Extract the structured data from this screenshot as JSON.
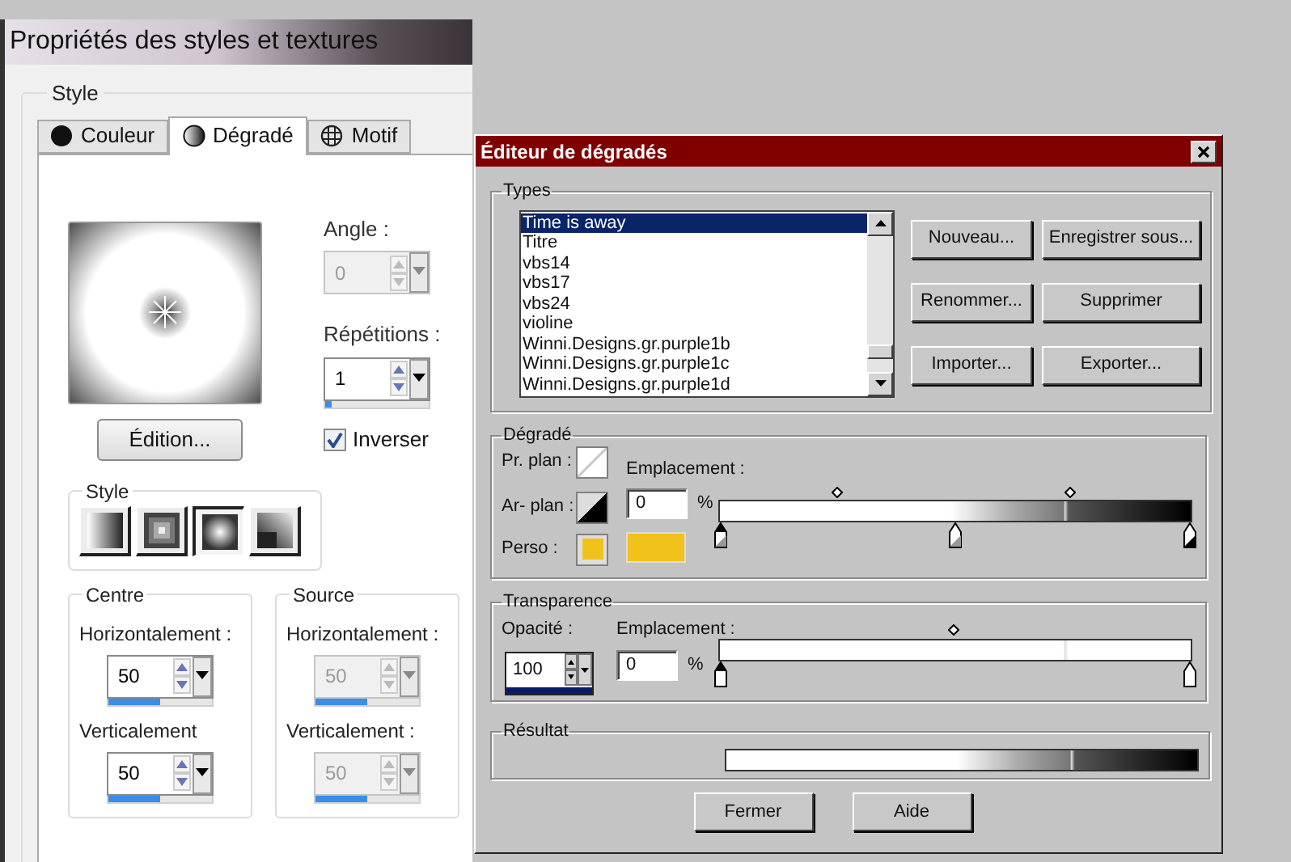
{
  "style_window": {
    "title": "Propriétés des styles et textures",
    "group_label": "Style",
    "tabs": [
      {
        "label": "Couleur",
        "kind": "color",
        "selected": false
      },
      {
        "label": "Dégradé",
        "kind": "gradient",
        "selected": true
      },
      {
        "label": "Motif",
        "kind": "pattern",
        "selected": false
      }
    ],
    "angle": {
      "label": "Angle :",
      "value": "0",
      "disabled": true
    },
    "repetitions": {
      "label": "Répétitions :",
      "value": "1",
      "disabled": false,
      "level": 0.06
    },
    "edit_button": "Édition...",
    "invert": {
      "label": "Inverser",
      "checked": true
    },
    "style_group": {
      "label": "Style",
      "options": [
        {
          "kind": "linear",
          "selected": false
        },
        {
          "kind": "rectangular",
          "selected": false
        },
        {
          "kind": "sunburst",
          "selected": true
        },
        {
          "kind": "radial",
          "selected": false
        }
      ]
    },
    "centre": {
      "label": "Centre",
      "fields": [
        {
          "label": "Horizontalement :",
          "value": "50",
          "disabled": false,
          "level": 0.5
        },
        {
          "label": "Verticalement",
          "value": "50",
          "disabled": false,
          "level": 0.5
        }
      ]
    },
    "source": {
      "label": "Source",
      "fields": [
        {
          "label": "Horizontalement :",
          "value": "50",
          "disabled": true,
          "level": 0.5
        },
        {
          "label": "Verticalement :",
          "value": "50",
          "disabled": true,
          "level": 0.5
        }
      ]
    }
  },
  "gradient_editor": {
    "title": "Éditeur de dégradés",
    "types": {
      "label": "Types",
      "items": [
        {
          "label": "Time is away",
          "selected": true
        },
        {
          "label": "Titre",
          "selected": false
        },
        {
          "label": "vbs14",
          "selected": false
        },
        {
          "label": "vbs17",
          "selected": false
        },
        {
          "label": "vbs24",
          "selected": false
        },
        {
          "label": "violine",
          "selected": false
        },
        {
          "label": "Winni.Designs.gr.purple1b",
          "selected": false
        },
        {
          "label": "Winni.Designs.gr.purple1c",
          "selected": false
        },
        {
          "label": "Winni.Designs.gr.purple1d",
          "selected": false
        }
      ],
      "buttons": [
        "Nouveau...",
        "Enregistrer sous...",
        "Renommer...",
        "Supprimer",
        "Importer...",
        "Exporter..."
      ]
    },
    "gradient": {
      "label": "Dégradé",
      "foreground_label": "Pr. plan :",
      "background_label": "Ar- plan :",
      "custom_label": "Perso :",
      "location_label": "Emplacement :",
      "location": "0",
      "unit": "%"
    },
    "transparency": {
      "label": "Transparence",
      "opacity_label": "Opacité :",
      "opacity": "100",
      "location_label": "Emplacement :",
      "location": "0",
      "unit": "%"
    },
    "result": {
      "label": "Résultat"
    },
    "footer_buttons": [
      "Fermer",
      "Aide"
    ]
  }
}
